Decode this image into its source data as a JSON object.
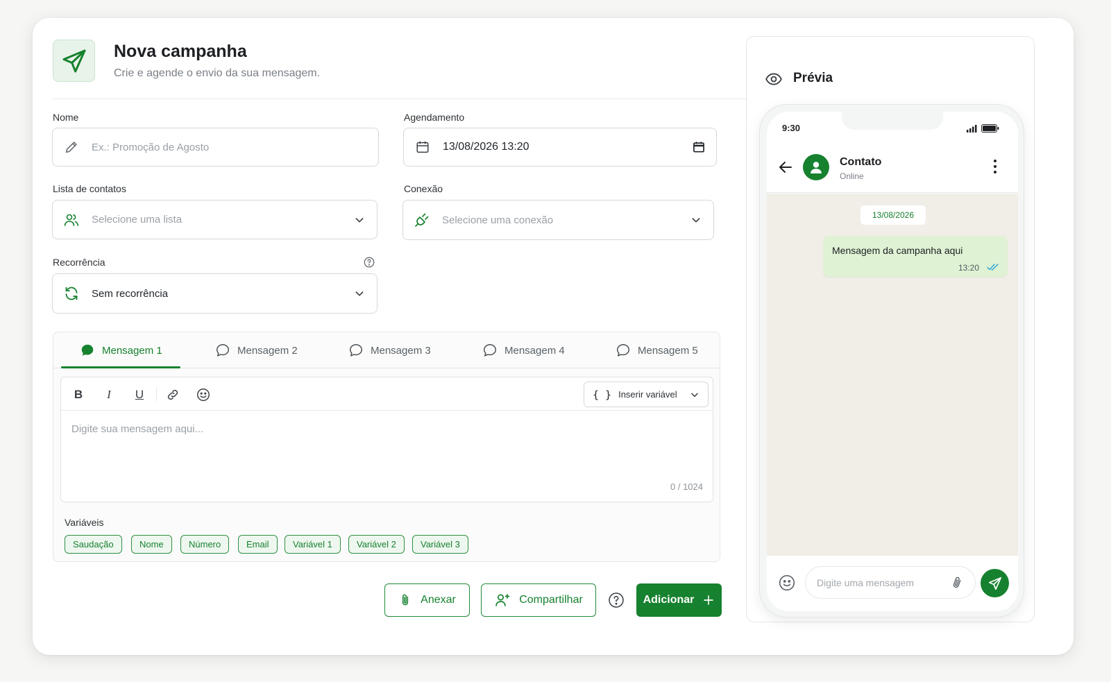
{
  "header": {
    "title": "Nova campanha",
    "subtitle": "Crie e agende o envio da sua mensagem."
  },
  "form": {
    "name": {
      "label": "Nome",
      "placeholder": "Ex.: Promoção de Agosto",
      "value": ""
    },
    "schedule": {
      "label": "Agendamento",
      "value": "13/08/2026 13:20"
    },
    "contact_list": {
      "label": "Lista de contatos",
      "placeholder": "Selecione uma lista"
    },
    "connection": {
      "label": "Conexão",
      "placeholder": "Selecione uma conexão"
    },
    "recurrence": {
      "label": "Recorrência",
      "value": "Sem recorrência"
    }
  },
  "message_tabs": [
    "Mensagem 1",
    "Mensagem 2",
    "Mensagem 3",
    "Mensagem 4",
    "Mensagem 5"
  ],
  "active_tab": "Mensagem 1",
  "editor": {
    "toolbar": {
      "bold": "B",
      "italic": "I",
      "underline": "U"
    },
    "insert_variable": "Inserir variável",
    "placeholder": "Digite sua mensagem aqui...",
    "counter": "0 / 1024"
  },
  "variables": {
    "label": "Variáveis",
    "chips": [
      "Saudação",
      "Nome",
      "Número",
      "Email",
      "Variável 1",
      "Variável 2",
      "Variável 3"
    ]
  },
  "actions": {
    "attach": "Anexar",
    "share": "Compartilhar",
    "add": "Adicionar"
  },
  "preview": {
    "title": "Prévia",
    "status_time": "9:30",
    "contact_name": "Contato",
    "contact_status": "Online",
    "date": "13/08/2026",
    "bubble_text": "Mensagem da campanha aqui",
    "bubble_time": "13:20",
    "input_placeholder": "Digite uma mensagem"
  },
  "colors": {
    "accent": "#16812e",
    "accent_light": "#eef7ef",
    "bubble": "#dff2d4",
    "chat_bg": "#f1eee8"
  }
}
